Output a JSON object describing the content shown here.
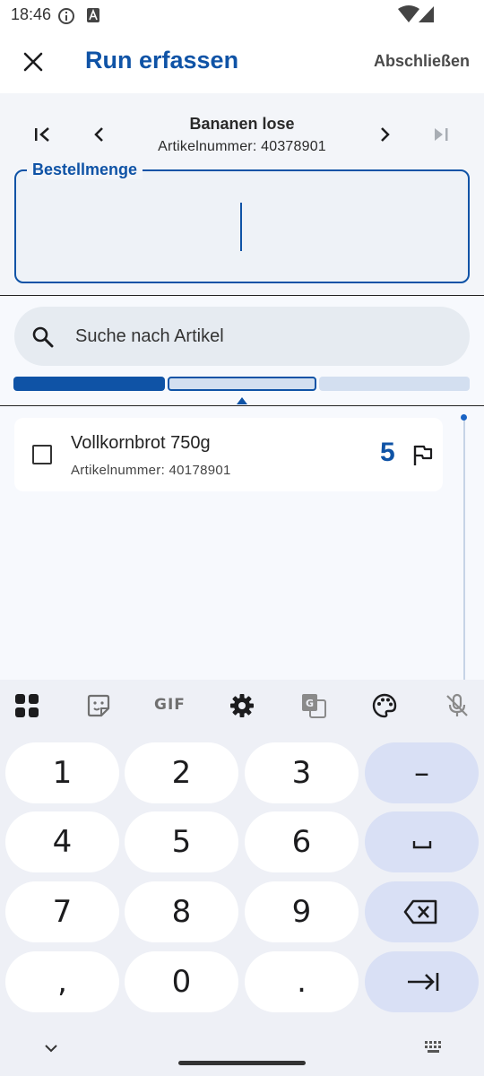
{
  "status_bar": {
    "time": "18:46"
  },
  "app_bar": {
    "title": "Run erfassen",
    "action": "Abschließen"
  },
  "product": {
    "name": "Bananen lose",
    "number": "Artikelnummer: 40378901"
  },
  "quantity_field": {
    "label": "Bestellmenge",
    "value": ""
  },
  "search": {
    "placeholder": "Suche nach Artikel"
  },
  "progress": {
    "segments": 3,
    "active_segment": 2
  },
  "items": [
    {
      "name": "Vollkornbrot 750g",
      "number": "Artikelnummer: 40178901",
      "quantity": "5",
      "checked": false
    }
  ],
  "keyboard": {
    "toolbar": [
      "apps-grid-icon",
      "sticker-icon",
      "GIF",
      "gear-icon",
      "translate-icon",
      "palette-icon",
      "mic-off-icon"
    ],
    "gif_label": "GIF",
    "keys": {
      "k1": "1",
      "k2": "2",
      "k3": "3",
      "minus": "–",
      "k4": "4",
      "k5": "5",
      "k6": "6",
      "k7": "7",
      "k8": "8",
      "k9": "9",
      "comma": ",",
      "k0": "0",
      "period": "."
    }
  },
  "colors": {
    "accent": "#0f53a6",
    "key_fn": "#d9e0f5",
    "key": "#ffffff"
  }
}
